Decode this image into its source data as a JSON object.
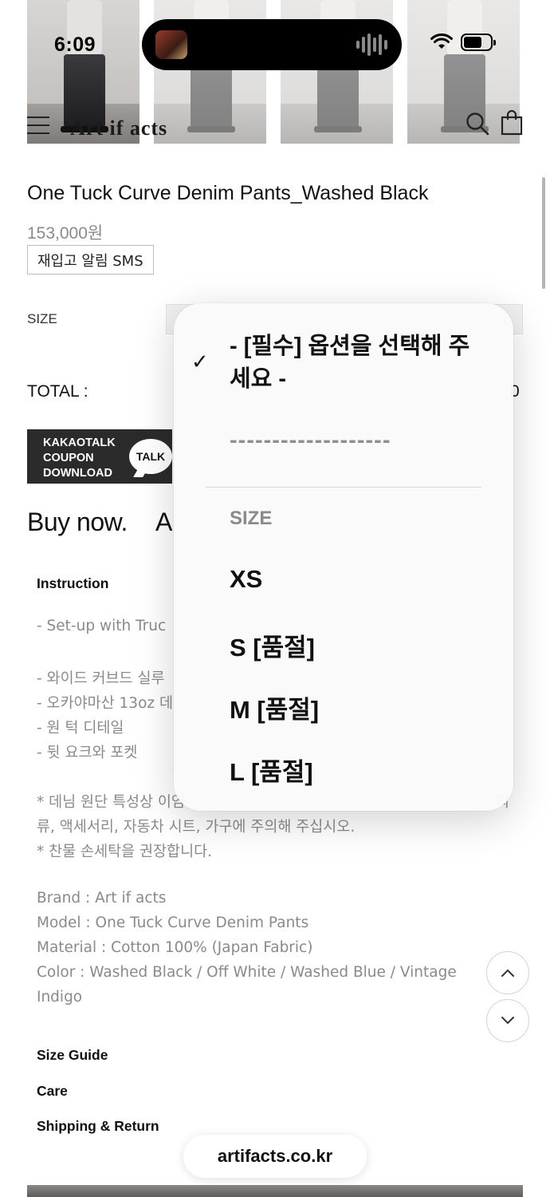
{
  "status_bar": {
    "time": "6:09"
  },
  "header": {
    "logo": "Art if acts",
    "menu_icon": "hamburger-icon",
    "search_icon": "search-icon",
    "bag_icon": "shopping-bag-icon"
  },
  "product": {
    "title": "One Tuck Curve Denim Pants_Washed Black",
    "price": "153,000원",
    "restock_button": "재입고 알림 SMS",
    "size_label": "SIZE",
    "total_label": "TOTAL :",
    "total_value": "0"
  },
  "kakao": {
    "line1": "KAKAOTALK",
    "line2": "COUPON",
    "line3": "DOWNLOAD",
    "bubble": "TALK"
  },
  "actions": {
    "buy_now": "Buy now.",
    "add_cart": "A"
  },
  "details": {
    "instruction_title": "Instruction",
    "setup_line": "- Set-up with Truc",
    "feature_1": "- 와이드 커브드 실루",
    "feature_2": "- 오카야마산 13oz 데",
    "feature_3": "- 원 턱 디테일",
    "feature_4": "- 뒷 요크와 포켓",
    "note_1a": "* 데님 원단 특성상 이염",
    "note_1b_end": "의",
    "note_1c": "류, 액세서리, 자동차 시트, 가구에 주의해 주십시오.",
    "note_2": "* 찬물 손세탁을 권장합니다.",
    "brand": "Brand : Art if acts",
    "model": "Model : One Tuck Curve Denim Pants",
    "material": "Material : Cotton 100% (Japan Fabric)",
    "color": "Color : Washed Black / Off White / Washed Blue / Vintage",
    "color_cont": "Indigo",
    "size_guide": "Size Guide",
    "care": "Care",
    "shipping": "Shipping & Return"
  },
  "scroll": {
    "up_icon": "chevron-up-icon",
    "down_icon": "chevron-down-icon"
  },
  "url_bar": {
    "domain": "artifacts.co.kr"
  },
  "dropdown": {
    "selected": "- [필수] 옵션을 선택해 주세요 -",
    "divider_option": "-------------------",
    "group_label": "SIZE",
    "options": [
      "XS",
      "S [품절]",
      "M [품절]",
      "L [품절]"
    ]
  }
}
